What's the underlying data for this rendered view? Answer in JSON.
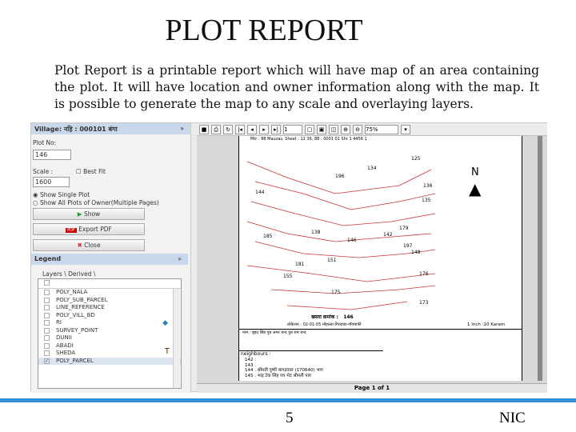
{
  "slide": {
    "title": "PLOT REPORT",
    "description": "Plot Report is a printable report which will have map of an area containing the plot. It will have location and owner information along with the map. It is possible to generate the map to any scale and overlaying layers.",
    "page_number": "5",
    "footer": "NIC"
  },
  "panel": {
    "village_header": "Village: नहि : 000101 बंगा",
    "plot_no_label": "Plot No:",
    "plot_no_value": "146",
    "scale_label": "Scale :",
    "best_fit_label": "Best Fit",
    "scale_value": "1600",
    "radio_single": "Show Single Plot",
    "radio_all": "Show All Plots of Owner(Multiple Pages)",
    "show_button": "Show",
    "export_button": "Export PDF",
    "pdf_icon_text": "PDF",
    "close_button": "Close"
  },
  "legend": {
    "header": "Legend",
    "tabs": [
      "Layers",
      "Derived"
    ],
    "layers": [
      {
        "name": "POLY_NALA",
        "checked": false
      },
      {
        "name": "POLY_SUB_PARCEL",
        "checked": false
      },
      {
        "name": "LINE_REFERENCE",
        "checked": false
      },
      {
        "name": "POLY_VILL_BD",
        "checked": false
      },
      {
        "name": "RI",
        "checked": false
      },
      {
        "name": "SURVEY_POINT",
        "checked": false
      },
      {
        "name": "DUNII",
        "checked": false
      },
      {
        "name": "ABADI",
        "checked": false
      },
      {
        "name": "SHEDA",
        "checked": false
      },
      {
        "name": "POLY_PARCEL",
        "checked": true
      }
    ]
  },
  "viewer": {
    "page_input": "1",
    "zoom": "75%",
    "status": "Page 1 of 1",
    "report": {
      "header_line": "Mtr : 88 Mauzas, Sheet : 12 36, 88 : 0001 01 Shr 1 4456 1",
      "north": "N",
      "plot_label": "खसरा क्रमांक :",
      "plot_value": "146",
      "location": "लोकेशन : 02-01-05 मोहल्ला-गिरदावर-गाँवमाफी",
      "scale_text": "1 Inch :10 Karam",
      "owner_line": "नाम : बृहद सिंह पुत्र अमर चन्द पुत्र राम चन्द",
      "neighbours_label": "neighbours :",
      "neighbours": [
        "142 :",
        "143 .",
        "144 . श्रीमती पुष्पी बागड़वाल (170640) भाग",
        "145 . भाइ टेक सिंह पत्र भेद श्रीमती पत्रा"
      ],
      "plot_numbers": [
        "125",
        "134",
        "135",
        "136",
        "138",
        "144",
        "146",
        "142",
        "148",
        "176",
        "175",
        "173",
        "181",
        "185",
        "155",
        "151",
        "197",
        "196",
        "179"
      ]
    }
  }
}
